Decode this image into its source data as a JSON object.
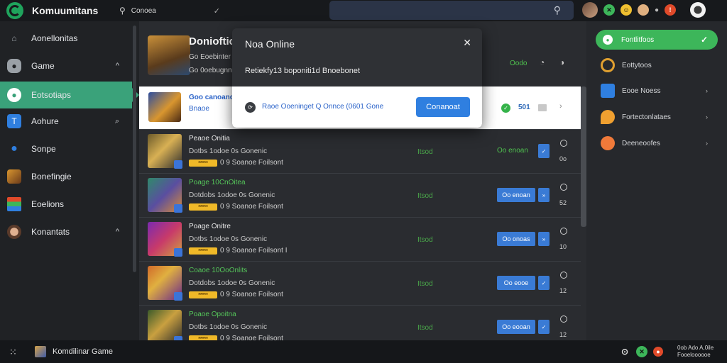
{
  "topbar": {
    "title": "Komuumitans",
    "search_placeholder": "Conoea",
    "search_check": "✓",
    "main_search_icon": "search-icon",
    "tray_dots": "●"
  },
  "sidebar": {
    "items": [
      {
        "label": "Aonellonitas",
        "icon": "home-icon",
        "color": "#9aa0a6",
        "chev": ""
      },
      {
        "label": "Game",
        "icon": "gamepad-icon",
        "color": "#9aa0a6",
        "chev": "^"
      },
      {
        "label": "Eotsotiaps",
        "icon": "chat-icon",
        "color": "#ffffff",
        "chev": ""
      },
      {
        "label": "Aohure",
        "icon": "tile-icon",
        "color": "#2f7fe0",
        "chev": "⌕"
      },
      {
        "label": "Sonpe",
        "icon": "user-icon",
        "color": "#2f7fe0",
        "chev": ""
      },
      {
        "label": "Bonefingie",
        "icon": "hero-icon",
        "color": "#d9962f",
        "chev": ""
      },
      {
        "label": "Eoelions",
        "icon": "flag-icon",
        "color": "#3db65a",
        "chev": ""
      },
      {
        "label": "Konantats",
        "icon": "avatar-icon",
        "color": "#a5673f",
        "chev": "^"
      }
    ]
  },
  "feature": {
    "title": "Donioftic",
    "sub1": "Go Eoebinter",
    "sub2": "Go 0oebugnnt",
    "status": "Oodo",
    "icon1": "bell-icon",
    "icon2": "settings-icon"
  },
  "highlight": {
    "name": "Goo canoanos",
    "sub": "Bnaoe",
    "badge": "✓",
    "count": "501",
    "chev": "›"
  },
  "rows": [
    {
      "name": "Peaoe Onitia",
      "name_green": false,
      "desc": "Dotbs 1odoe 0s Gonenic",
      "tag": "*****",
      "meta": "0 9 Soanoe Foilsont",
      "status": "Itsod",
      "action": "Oo enoan",
      "action_green": true,
      "mini": "✓",
      "num": "0o",
      "thumb": "linear-gradient(135deg,#6b5a2a,#d8b054 45%,#2d2d2d)"
    },
    {
      "name": "Poage 10CnOitea",
      "name_green": true,
      "desc": "Dotdobs 1odoe 0s Gonenic",
      "tag": "*****",
      "meta": "0 9 Soanoe Foilsont",
      "status": "Itsod",
      "action": "Oo enoan",
      "action_green": false,
      "mini": "»",
      "num": "52",
      "thumb": "linear-gradient(135deg,#2f8a6a,#5a4ea0 50%,#d58a3a)"
    },
    {
      "name": "Poage Onitre",
      "name_green": false,
      "desc": "Dotbs 1odoe 0s Gonenic",
      "tag": "*****",
      "meta": "0 9 Soanoe Foilsont I",
      "status": "Itsod",
      "action": "Oo onoas",
      "action_green": false,
      "mini": "»",
      "num": "10",
      "thumb": "linear-gradient(135deg,#7a2ab0,#c83a6a 50%,#d0a040)"
    },
    {
      "name": "Coaoe 10OoOnlits",
      "name_green": true,
      "desc": "Dotdobs 1odoe 0s Gonenic",
      "tag": "*****",
      "meta": "0 9 Soanoe Foilsont",
      "status": "Itsod",
      "action": "Oo eooe",
      "action_green": false,
      "mini": "✓",
      "num": "12",
      "thumb": "linear-gradient(135deg,#d06a2a,#e0b040 40%,#6a2a8a)"
    },
    {
      "name": "Poaoe Opoitna",
      "name_green": true,
      "desc": "Dotbs 1odoe 0s Gonenic",
      "tag": "*****",
      "meta": "0 9 Soanoe Foilsont",
      "status": "Itsod",
      "action": "Oo eooan",
      "action_green": false,
      "mini": "✓",
      "num": "12",
      "thumb": "linear-gradient(135deg,#3a5a2a,#c9a040 45%,#2a2a2a)"
    }
  ],
  "right_panel": {
    "active": {
      "label": "Fontlitfoos",
      "check": "✓"
    },
    "items": [
      {
        "label": "Eottytoos",
        "icon": "trophy-icon",
        "color": "#e0a030",
        "chev": ""
      },
      {
        "label": "Eooe Noess",
        "icon": "grid-icon",
        "color": "#2f7fe0",
        "chev": "›"
      },
      {
        "label": "Fortectonlataes",
        "icon": "map-pin-icon",
        "color": "#f0a030",
        "chev": "›"
      },
      {
        "label": "Deeneoofes",
        "icon": "gift-icon",
        "color": "#f07a3a",
        "chev": "›"
      }
    ]
  },
  "modal": {
    "title": "Noa Online",
    "close": "✕",
    "message": "Retiekfy13 boponiti1d Bnoebonet",
    "footer_text": "Raoe Ooeninget Q Onnce (0601 Gone",
    "footer_icon": "link-icon",
    "button": "Conanoat"
  },
  "taskbar": {
    "label": "Komdilinar Game",
    "grid_icon": "apps-icon",
    "time_line1": "0ob Ado A,0ile",
    "time_line2": "Fooeloooooe"
  }
}
